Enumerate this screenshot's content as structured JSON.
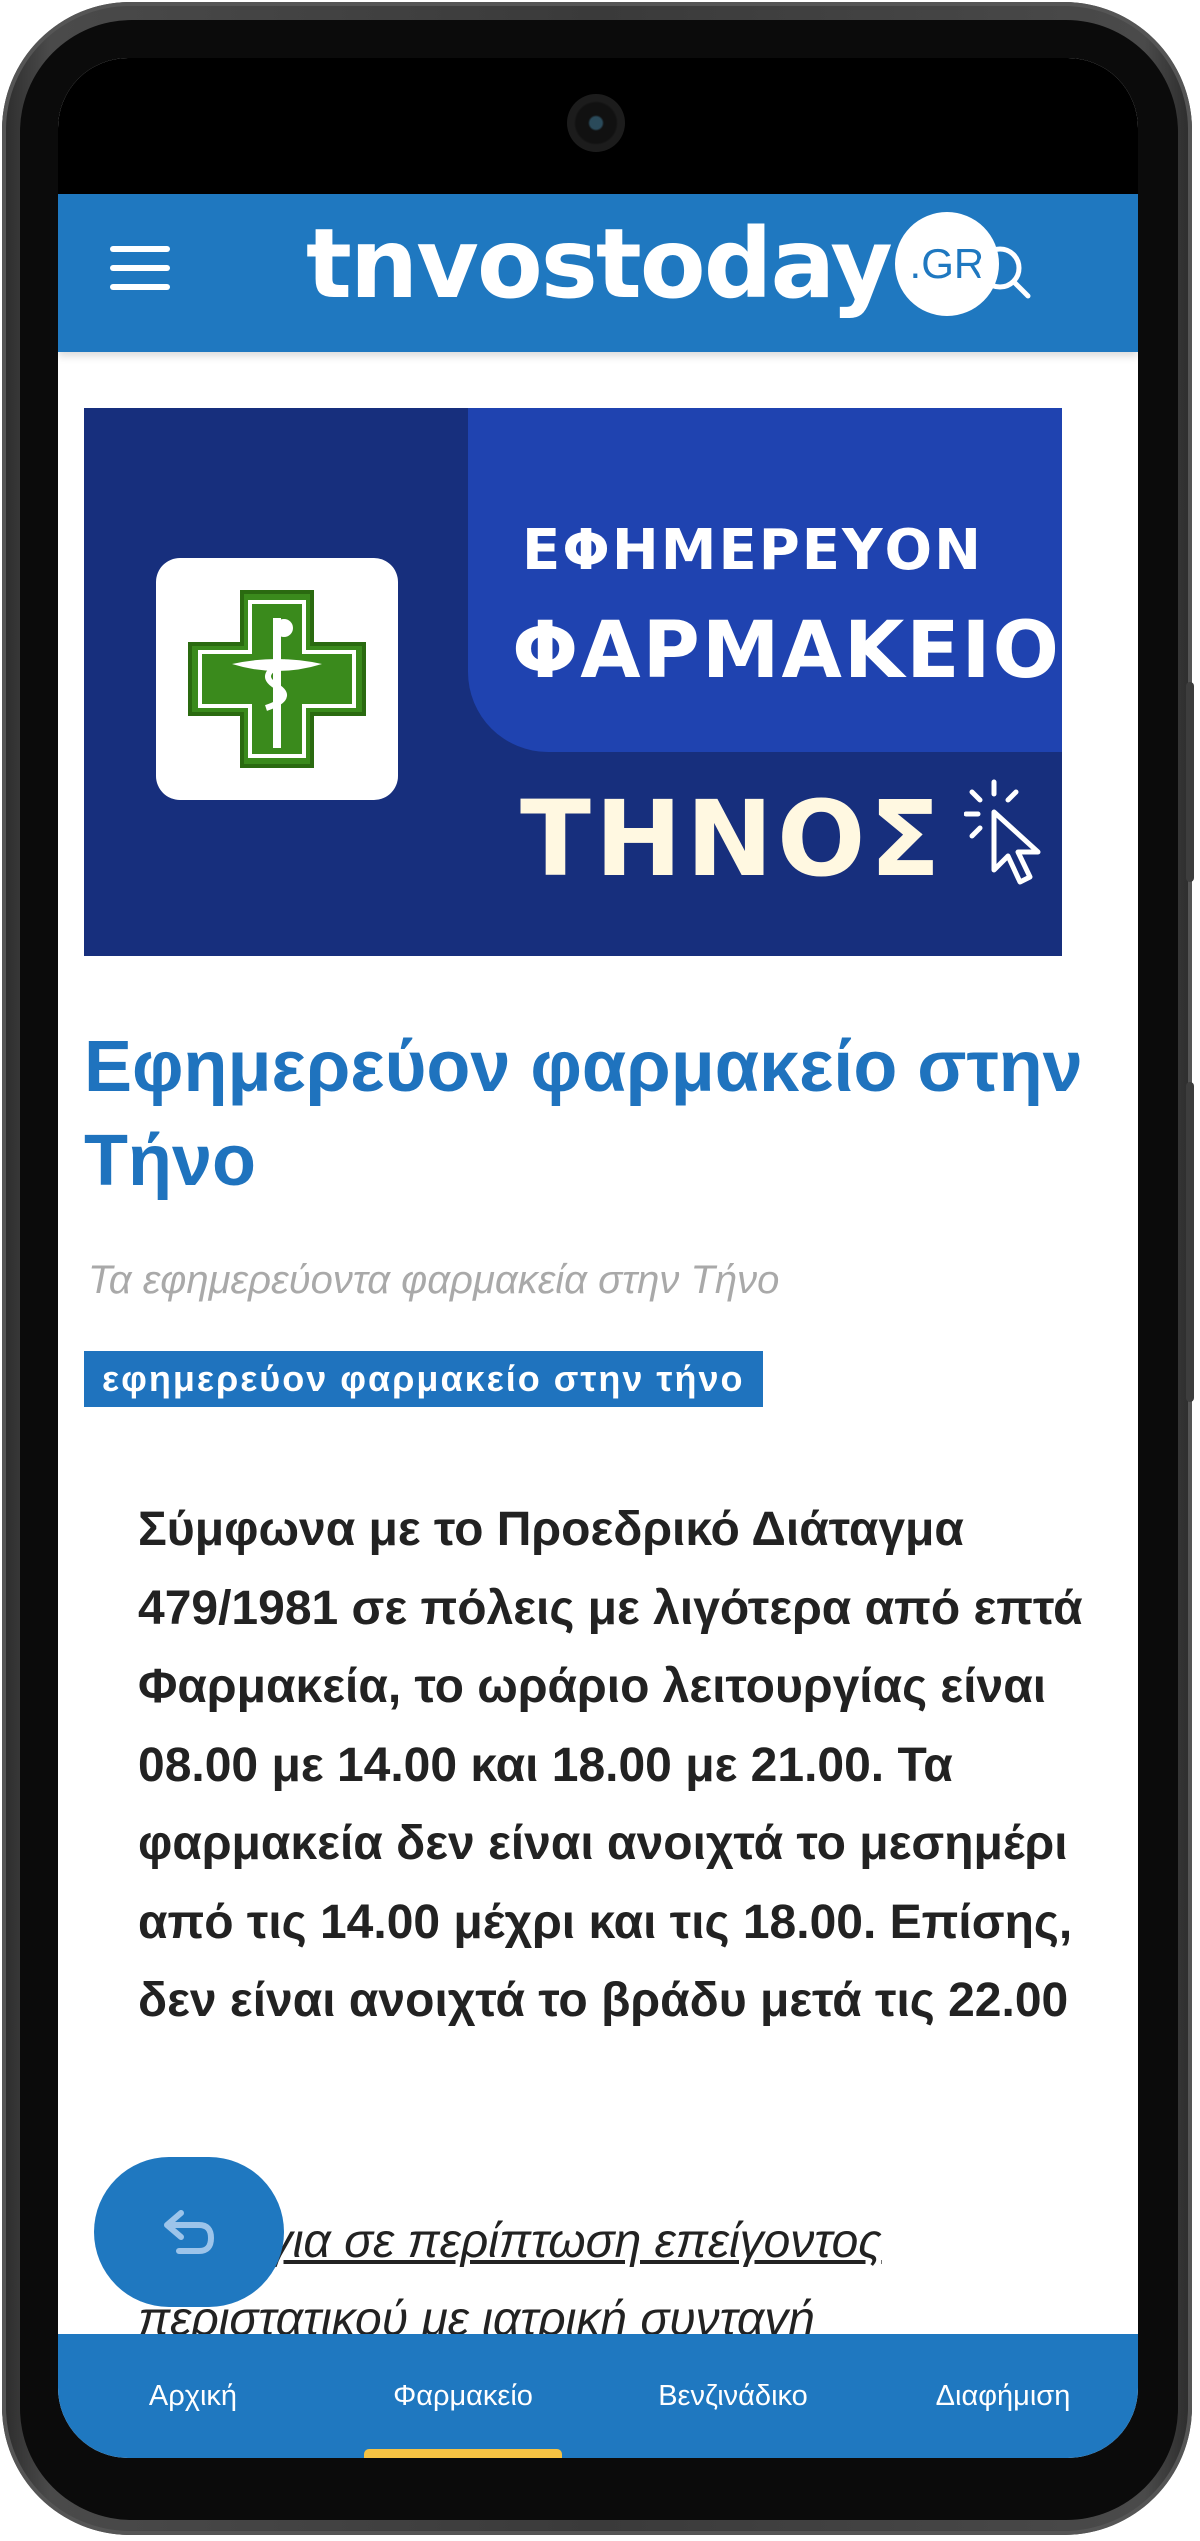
{
  "header": {
    "logo_text": "tnvostoday",
    "logo_badge": ".GR"
  },
  "banner": {
    "line1": "ΕΦΗΜΕΡΕΥΟΝ",
    "line2": "ΦΑΡΜΑΚΕΙΟ",
    "line3": "ΤΗΝΟΣ"
  },
  "article": {
    "title": "Εφημερεύον φαρμακείο στην Τήνο",
    "subtitle": "Τα εφημερεύοντα φαρμακεία στην Τήνο",
    "tag": "εφημερεύον φαρμακείο στην τήνο",
    "body": "Σύμφωνα με το Προεδρικό Διάταγμα 479/1981 σε πόλεις με λιγότερα από επτά Φαρμακεία, το ωράριο λειτουργίας είναι 08.00 με 14.00 και 18.00 με 21.00. Τα φαρμακεία δεν είναι ανοιχτά το μεσημέρι από τις 14.00 μέχρι και τις 18.00. Επίσης, δεν είναι ανοιχτά το βράδυ μετά τις 22.00",
    "link": "Μόνο για σε περίπτωση επείγοντος περιστατικού με ιατρική συνταγή"
  },
  "bottom_nav": {
    "items": [
      {
        "label": "Αρχική",
        "active": false
      },
      {
        "label": "Φαρμακείο",
        "active": true
      },
      {
        "label": "Βενζινάδικο",
        "active": false
      },
      {
        "label": "Διαφήμιση",
        "active": false
      }
    ]
  },
  "colors": {
    "brand_blue": "#1f78c0",
    "title_blue": "#1f73be",
    "banner_dark": "#172f7d",
    "banner_light": "#1f43b0",
    "pharmacy_green": "#3a8a1c",
    "nav_indicator": "#f6c243"
  },
  "icons": {
    "menu": "hamburger-menu-icon",
    "search": "search-icon",
    "pharmacy": "pharmacy-cross-icon",
    "cursor": "click-cursor-icon",
    "back": "back-arrow-icon"
  }
}
